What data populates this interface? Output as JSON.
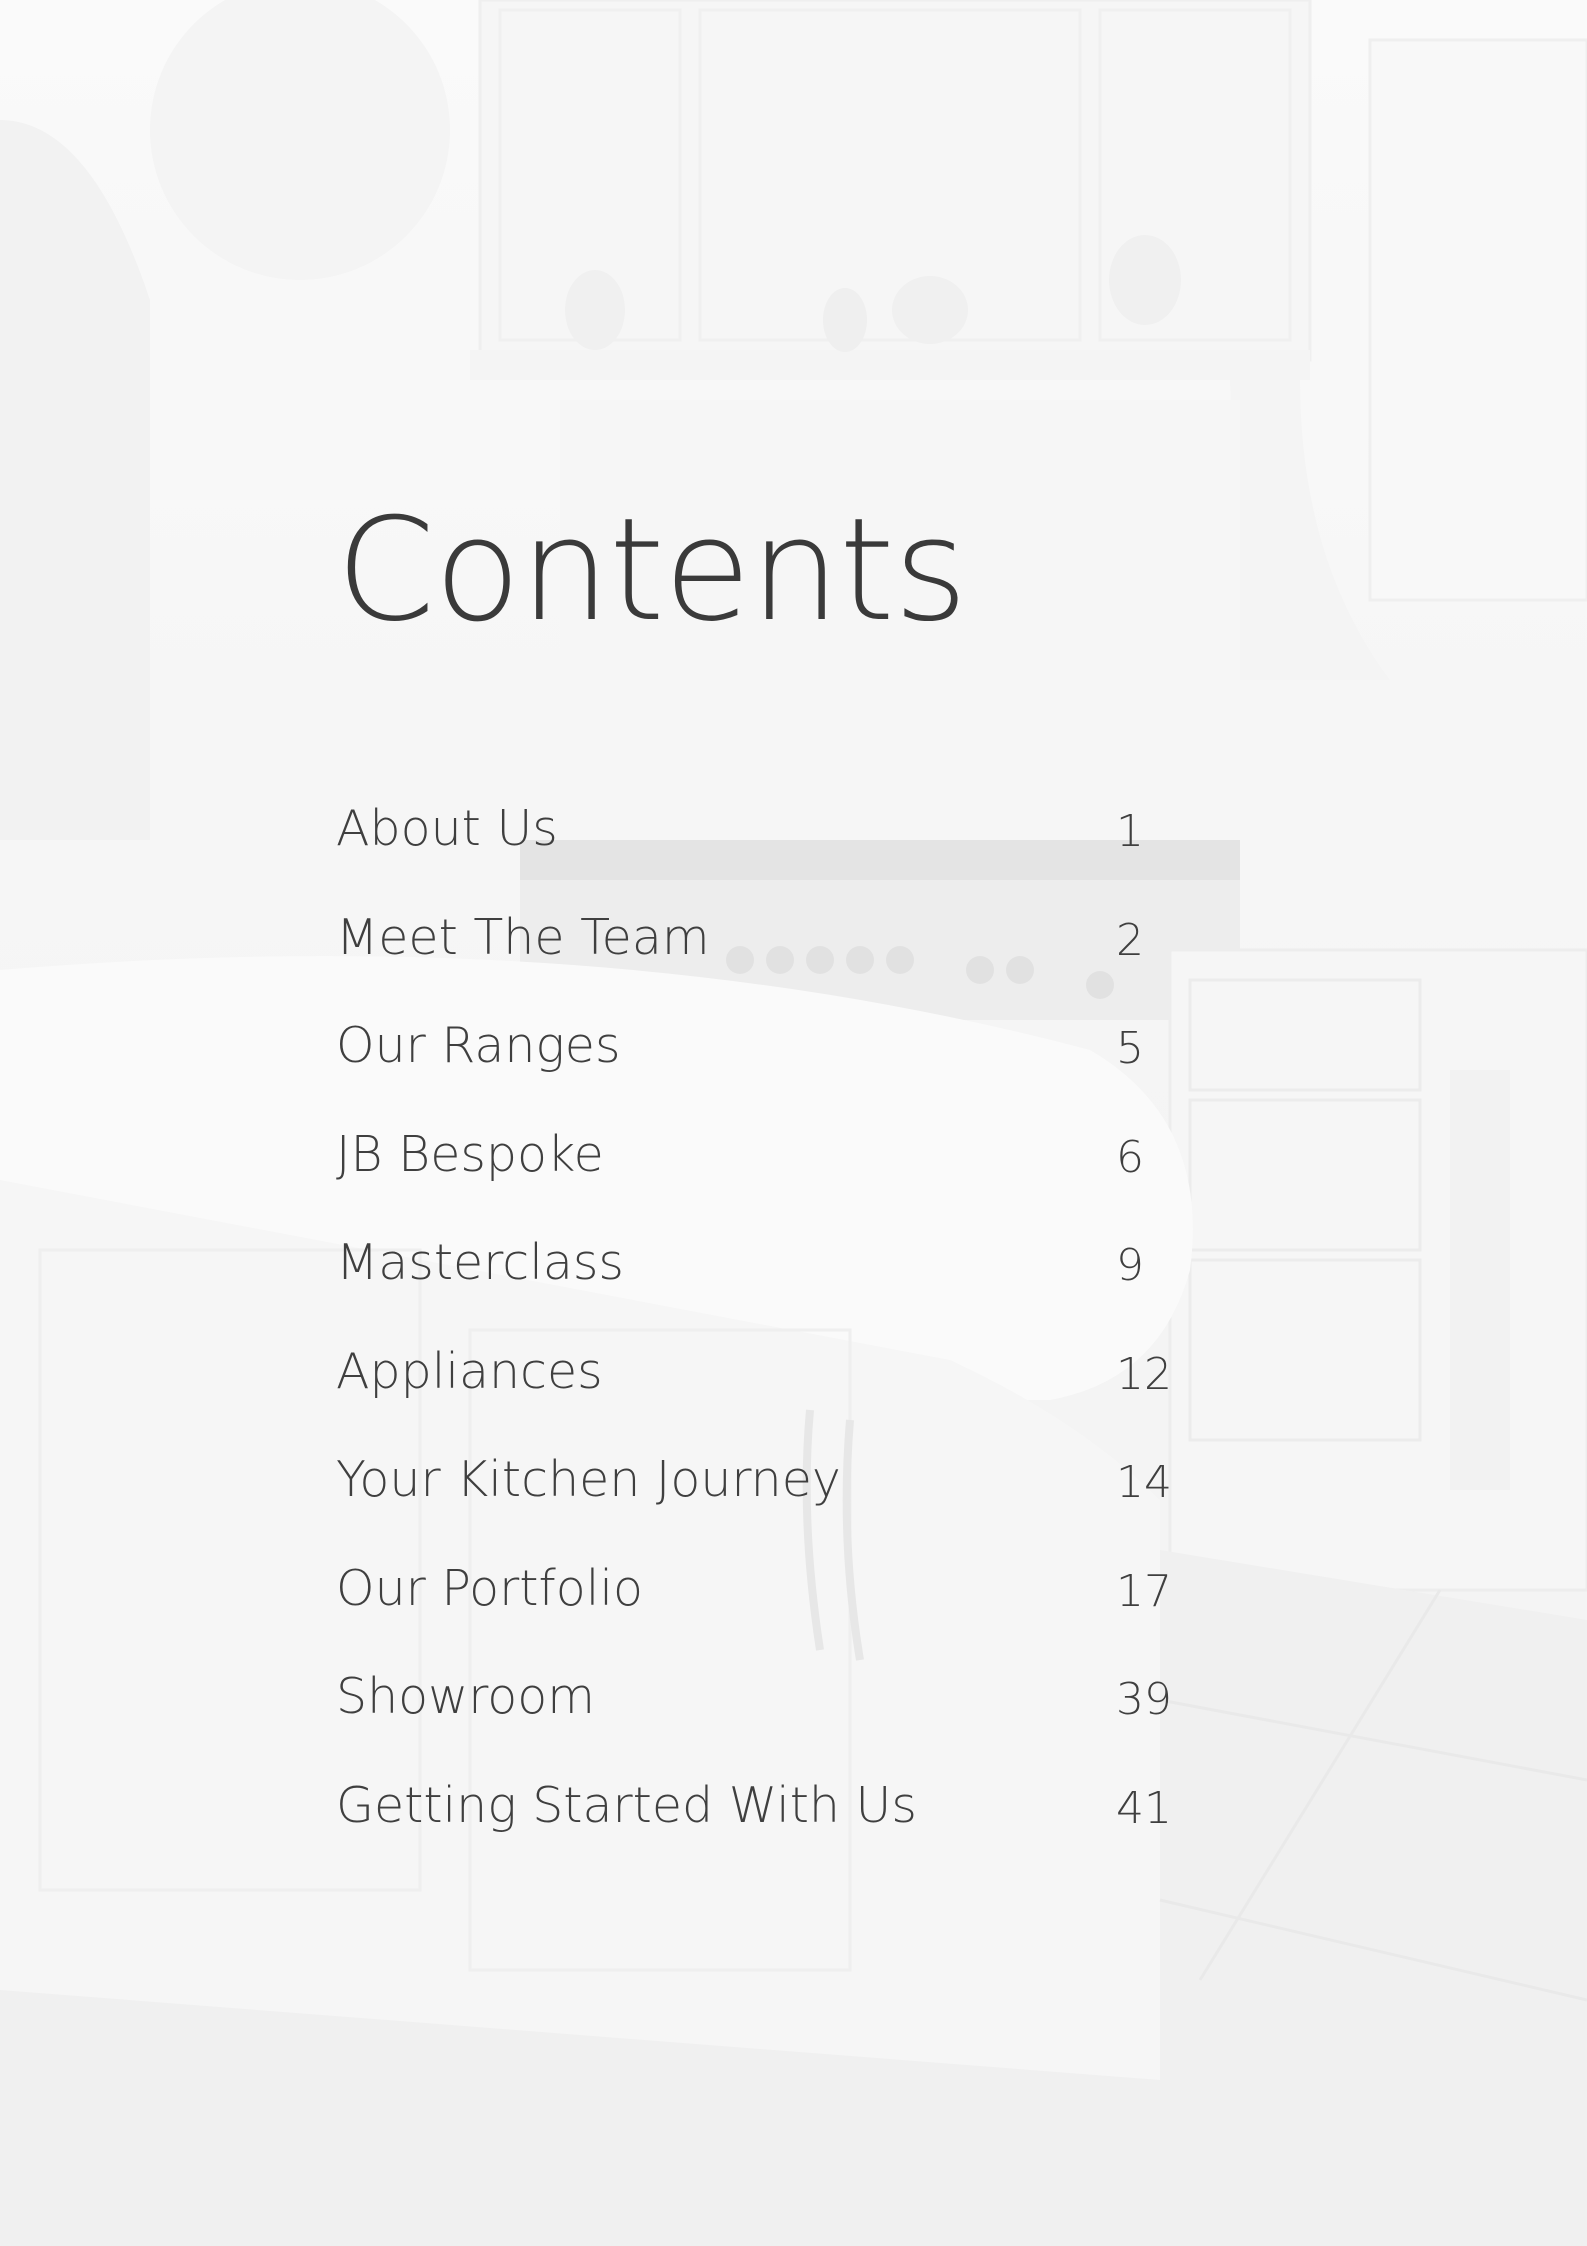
{
  "title": "Contents",
  "entries": [
    {
      "label": "About Us",
      "page": "1"
    },
    {
      "label": "Meet The Team",
      "page": "2"
    },
    {
      "label": "Our Ranges",
      "page": "5"
    },
    {
      "label": "JB Bespoke",
      "page": "6"
    },
    {
      "label": "Masterclass",
      "page": "9"
    },
    {
      "label": "Appliances",
      "page": "12"
    },
    {
      "label": "Your Kitchen Journey",
      "page": "14"
    },
    {
      "label": "Our Portfolio",
      "page": "17"
    },
    {
      "label": "Showroom",
      "page": "39"
    },
    {
      "label": "Getting Started With Us",
      "page": "41"
    }
  ]
}
